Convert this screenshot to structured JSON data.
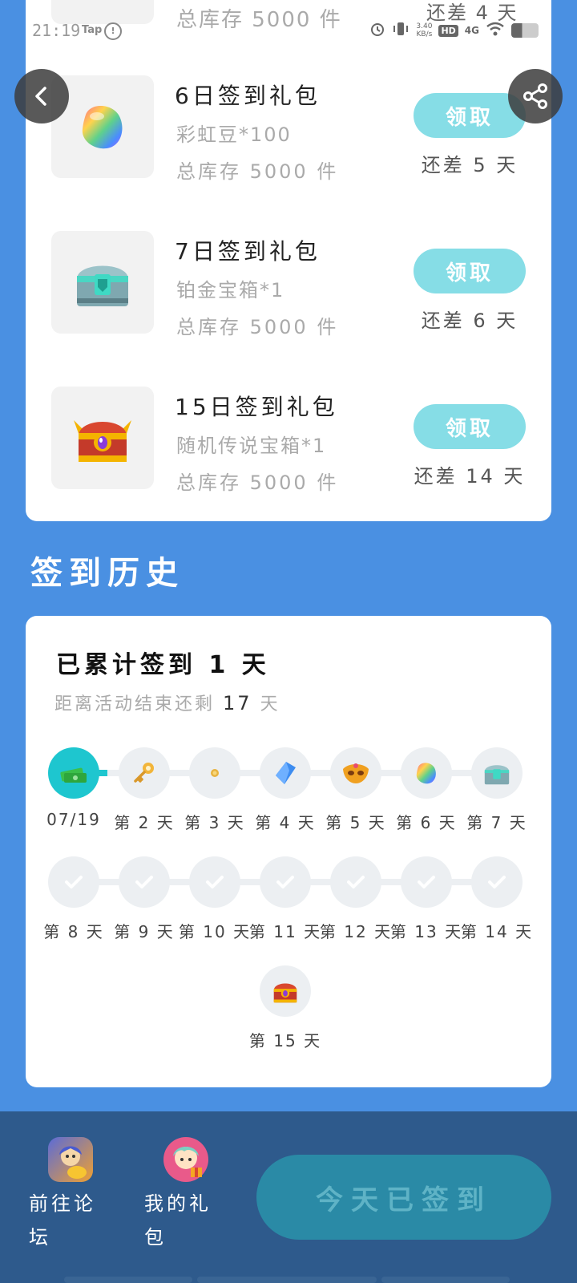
{
  "status_bar": {
    "time": "21:19",
    "tap_label": "Tap",
    "speed": "3.40",
    "speed_unit": "KB/s",
    "hd": "HD",
    "network": "4G"
  },
  "previous_item": {
    "stock": "总库存 5000 件",
    "remain": "还差 4 天"
  },
  "gifts": [
    {
      "title": "6日签到礼包",
      "item": "彩虹豆*100",
      "stock": "总库存 5000 件",
      "button": "领取",
      "remain": "还差 5 天",
      "icon": "rainbow-bean-icon"
    },
    {
      "title": "7日签到礼包",
      "item": "铂金宝箱*1",
      "stock": "总库存 5000 件",
      "button": "领取",
      "remain": "还差 6 天",
      "icon": "platinum-chest-icon"
    },
    {
      "title": "15日签到礼包",
      "item": "随机传说宝箱*1",
      "stock": "总库存 5000 件",
      "button": "领取",
      "remain": "还差 14 天",
      "icon": "legendary-chest-icon"
    }
  ],
  "history": {
    "heading": "签到历史",
    "total": "已累计签到 1 天",
    "sub_prefix": "距离活动结束还剩",
    "sub_days": "17",
    "sub_suffix": "天",
    "row1": [
      {
        "label": "07/19",
        "icon": "cash-icon"
      },
      {
        "label": "第 2 天",
        "icon": "key-icon"
      },
      {
        "label": "第 3 天",
        "icon": "coin-icon"
      },
      {
        "label": "第 4 天",
        "icon": "crystal-icon"
      },
      {
        "label": "第 5 天",
        "icon": "mask-icon"
      },
      {
        "label": "第 6 天",
        "icon": "rainbow-bean-icon"
      },
      {
        "label": "第 7 天",
        "icon": "platinum-chest-icon"
      }
    ],
    "row2": [
      {
        "label": "第 8 天"
      },
      {
        "label": "第 9 天"
      },
      {
        "label": "第 10 天"
      },
      {
        "label": "第 11 天"
      },
      {
        "label": "第 12 天"
      },
      {
        "label": "第 13 天"
      },
      {
        "label": "第 14 天"
      }
    ],
    "day15": {
      "label": "第 15 天",
      "icon": "legendary-chest-icon"
    },
    "colors": {
      "accent": "#1ec6cf",
      "track": "#eceff2"
    }
  },
  "bottom": {
    "forum_label": "前往论坛",
    "gifts_label": "我的礼包",
    "signed_button": "今天已签到"
  },
  "colors": {
    "background": "#4a90e2",
    "claim_button": "#86dde6",
    "bottom_bar": "#2e5a8c"
  }
}
